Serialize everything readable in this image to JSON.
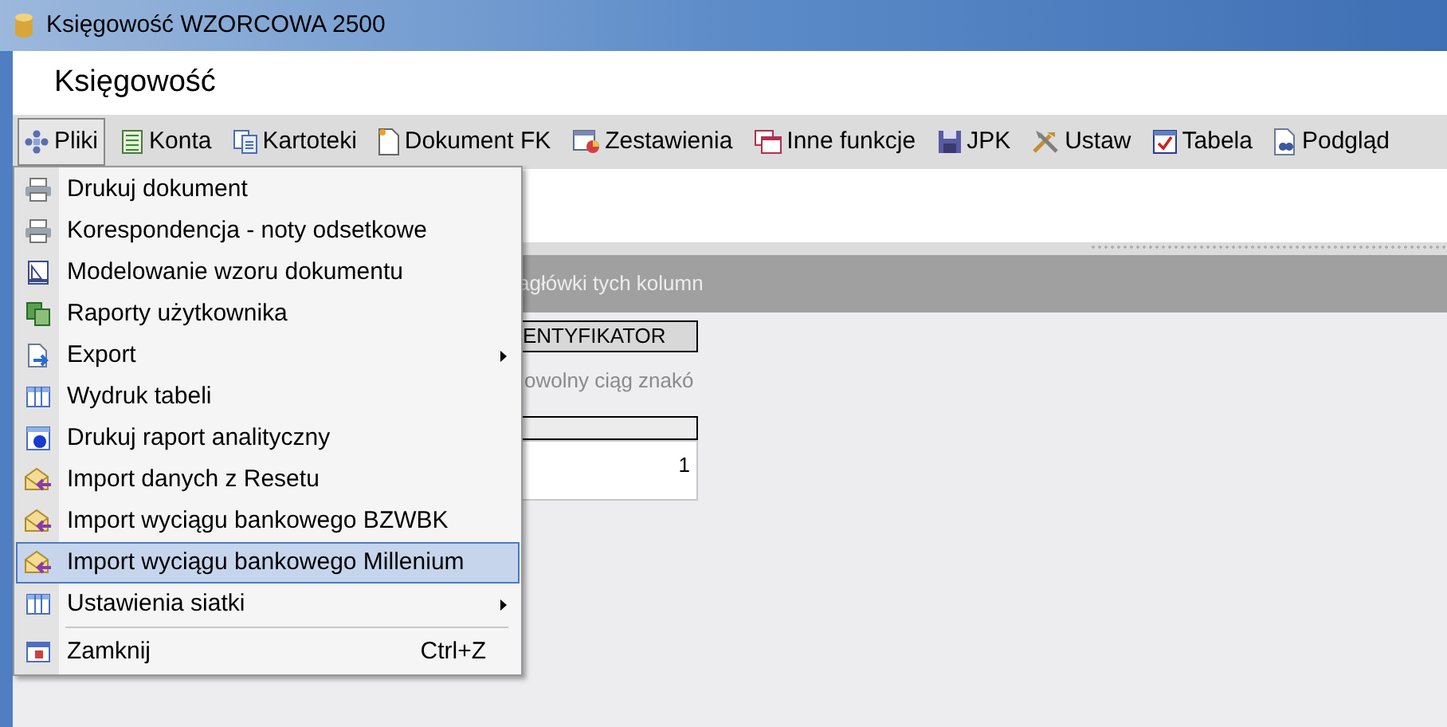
{
  "window": {
    "title": "Księgowość WZORCOWA 2500"
  },
  "header": {
    "title": "Księgowość"
  },
  "toolbar": [
    {
      "label": "Pliki",
      "selected": true
    },
    {
      "label": "Konta",
      "selected": false
    },
    {
      "label": "Kartoteki",
      "selected": false
    },
    {
      "label": "Dokument FK",
      "selected": false
    },
    {
      "label": "Zestawienia",
      "selected": false
    },
    {
      "label": "Inne funkcje",
      "selected": false
    },
    {
      "label": "JPK",
      "selected": false
    },
    {
      "label": "Ustaw",
      "selected": false
    },
    {
      "label": "Tabela",
      "selected": false
    },
    {
      "label": "Podgląd",
      "selected": false
    }
  ],
  "menu": [
    {
      "kind": "item",
      "label": "Drukuj dokument",
      "selected": false
    },
    {
      "kind": "item",
      "label": "Korespondencja - noty odsetkowe",
      "selected": false
    },
    {
      "kind": "item",
      "label": "Modelowanie wzoru dokumentu",
      "selected": false
    },
    {
      "kind": "item",
      "label": "Raporty użytkownika",
      "selected": false
    },
    {
      "kind": "item",
      "label": "Export",
      "selected": false,
      "submenu": true
    },
    {
      "kind": "item",
      "label": "Wydruk tabeli",
      "selected": false
    },
    {
      "kind": "item",
      "label": "Drukuj raport analityczny",
      "selected": false
    },
    {
      "kind": "item",
      "label": "Import danych z Resetu",
      "selected": false
    },
    {
      "kind": "item",
      "label": "Import wyciągu bankowego BZWBK",
      "selected": false
    },
    {
      "kind": "item",
      "label": "Import wyciągu bankowego Millenium",
      "selected": true
    },
    {
      "kind": "item",
      "label": "Ustawienia siatki",
      "selected": false,
      "submenu": true
    },
    {
      "kind": "separator"
    },
    {
      "kind": "item",
      "label": "Zamknij",
      "selected": false,
      "shortcut": "Ctrl+Z"
    }
  ],
  "group_band": {
    "text": "agłówki tych kolumn"
  },
  "grid": {
    "column_header": "ENTYFIKATOR",
    "description": "owolny ciąg znakó",
    "cell": "1"
  }
}
